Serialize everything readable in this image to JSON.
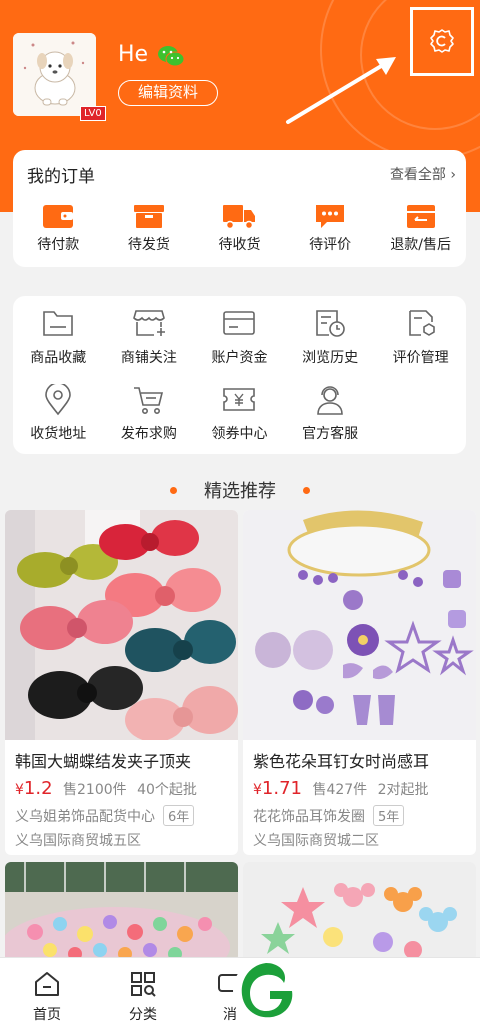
{
  "header": {
    "username": "He",
    "level": "LV0",
    "edit_profile": "编辑资料",
    "bg_color": "#ff6a13",
    "icons": [
      "wechat-icon",
      "settings-icon"
    ]
  },
  "orders": {
    "title": "我的订单",
    "view_all": "查看全部",
    "items": [
      {
        "label": "待付款",
        "icon": "wallet-icon"
      },
      {
        "label": "待发货",
        "icon": "box-icon"
      },
      {
        "label": "待收货",
        "icon": "truck-icon"
      },
      {
        "label": "待评价",
        "icon": "comment-icon"
      },
      {
        "label": "退款/售后",
        "icon": "refund-icon"
      }
    ]
  },
  "tools": {
    "row1": [
      {
        "label": "商品收藏",
        "icon": "folder-icon"
      },
      {
        "label": "商铺关注",
        "icon": "shop-icon"
      },
      {
        "label": "账户资金",
        "icon": "card-icon"
      },
      {
        "label": "浏览历史",
        "icon": "history-icon"
      },
      {
        "label": "评价管理",
        "icon": "review-icon"
      }
    ],
    "row2": [
      {
        "label": "收货地址",
        "icon": "location-icon"
      },
      {
        "label": "发布求购",
        "icon": "cart-icon"
      },
      {
        "label": "领券中心",
        "icon": "coupon-icon"
      },
      {
        "label": "官方客服",
        "icon": "service-icon"
      }
    ]
  },
  "recommend": {
    "title": "精选推荐",
    "products": [
      {
        "name": "韩国大蝴蝶结发夹子顶夹",
        "currency": "¥",
        "price": "1.2",
        "sold": "售2100件",
        "moq": "40个起批",
        "shop": "义乌姐弟饰品配货中心",
        "years": "6年",
        "address": "义乌国际商贸城五区"
      },
      {
        "name": "紫色花朵耳钉女时尚感耳",
        "currency": "¥",
        "price": "1.71",
        "sold": "售427件",
        "moq": "2对起批",
        "shop": "花花饰品耳饰发圈",
        "years": "5年",
        "address": "义乌国际商贸城二区"
      }
    ]
  },
  "bottom_nav": [
    {
      "label": "首页",
      "icon": "home-icon"
    },
    {
      "label": "分类",
      "icon": "category-icon"
    },
    {
      "label": "消",
      "icon": "message-icon"
    }
  ]
}
